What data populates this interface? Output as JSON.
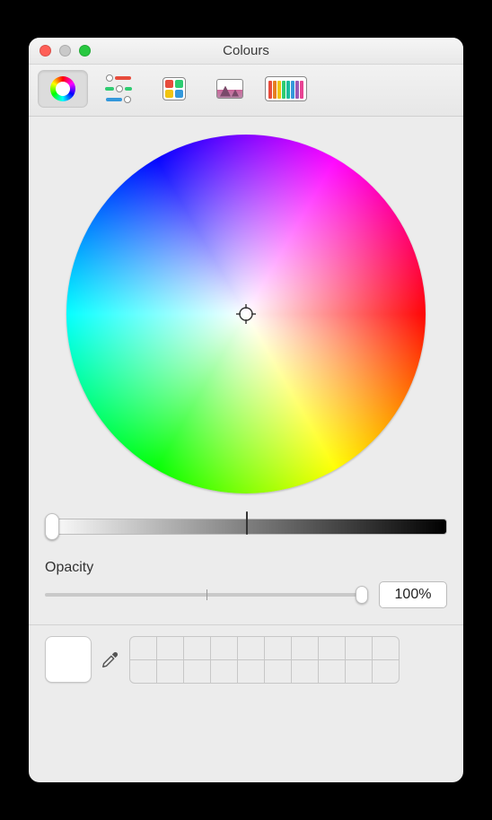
{
  "window": {
    "title": "Colours"
  },
  "tabs": [
    {
      "id": "wheel",
      "name": "Colour Wheel",
      "selected": true
    },
    {
      "id": "sliders",
      "name": "Colour Sliders",
      "selected": false
    },
    {
      "id": "palettes",
      "name": "Colour Palettes",
      "selected": false
    },
    {
      "id": "image",
      "name": "Image Palettes",
      "selected": false
    },
    {
      "id": "pencils",
      "name": "Pencils",
      "selected": false
    }
  ],
  "brightness": {
    "value": 100,
    "min": 0,
    "max": 100,
    "tick_at": 50
  },
  "opacity": {
    "label": "Opacity",
    "value": 100,
    "display": "100%",
    "min": 0,
    "max": 100,
    "tick_at": 50
  },
  "current_color": "#ffffff",
  "swatches": {
    "rows": 2,
    "cols": 10
  },
  "slider_colors": {
    "r": "#e74c3c",
    "g": "#2ecc71",
    "b": "#3498db"
  },
  "pencil_colors": [
    "#e74c3c",
    "#e67e22",
    "#f1c40f",
    "#2ecc71",
    "#1abc9c",
    "#3498db",
    "#9b59b6",
    "#e84393"
  ]
}
